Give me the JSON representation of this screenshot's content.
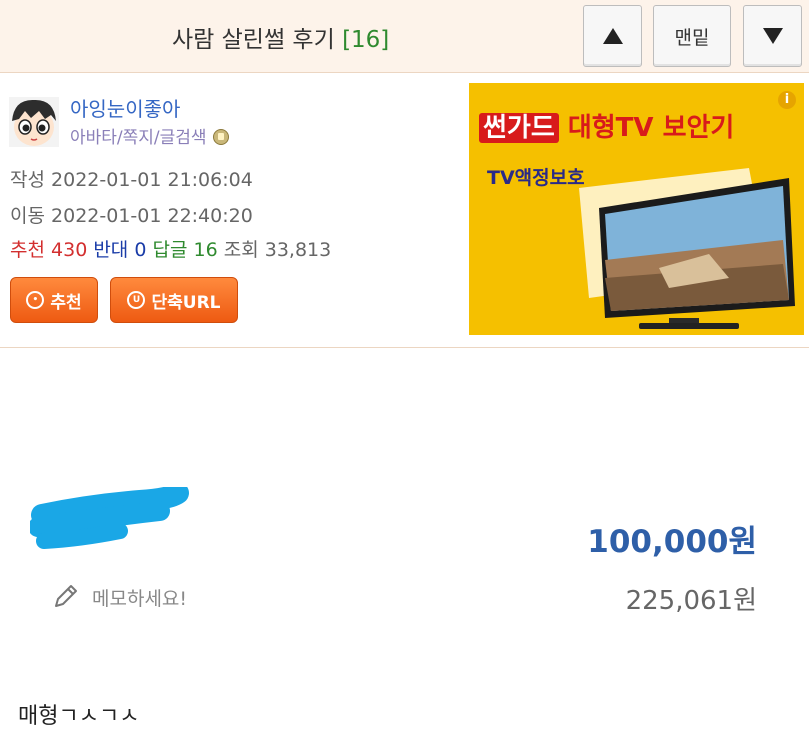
{
  "header": {
    "title": "사람 살린썰 후기",
    "comment_count": "[16]",
    "up_icon": "triangle-up-icon",
    "bottom_label": "맨밑",
    "down_icon": "triangle-down-icon"
  },
  "author": {
    "nickname": "아잉눈이좋아",
    "links": "아바타/쪽지/글검색"
  },
  "meta": {
    "write_label": "작성",
    "write_time": "2022-01-01 21:06:04",
    "move_label": "이동",
    "move_time": "2022-01-01 22:40:20"
  },
  "stats": {
    "rec_label": "추천",
    "rec_value": "430",
    "oppose_label": "반대",
    "oppose_value": "0",
    "reply_label": "답글",
    "reply_value": "16",
    "view_label": "조회",
    "view_value": "33,813"
  },
  "buttons": {
    "recommend": "추천",
    "short_url": "단축URL"
  },
  "ad": {
    "brand": "썬가드",
    "headline": "대형TV 보안기",
    "subline": "TV액정보호",
    "info_icon": "info-icon"
  },
  "content": {
    "price_main": "100,000원",
    "memo_placeholder": "메모하세요!",
    "price_sub": "225,061원",
    "bottom_text": "매형ㄱㅅㄱㅅ"
  },
  "colors": {
    "header_bg": "#fdf3ea",
    "nickname": "#3567c4",
    "orange_button": "#ee5a12",
    "recommend_red": "#d32f2f",
    "oppose_blue": "#1a3ca8",
    "reply_green": "#2f8a2f",
    "price_blue": "#2e5fa8",
    "ad_yellow": "#f5c000"
  }
}
